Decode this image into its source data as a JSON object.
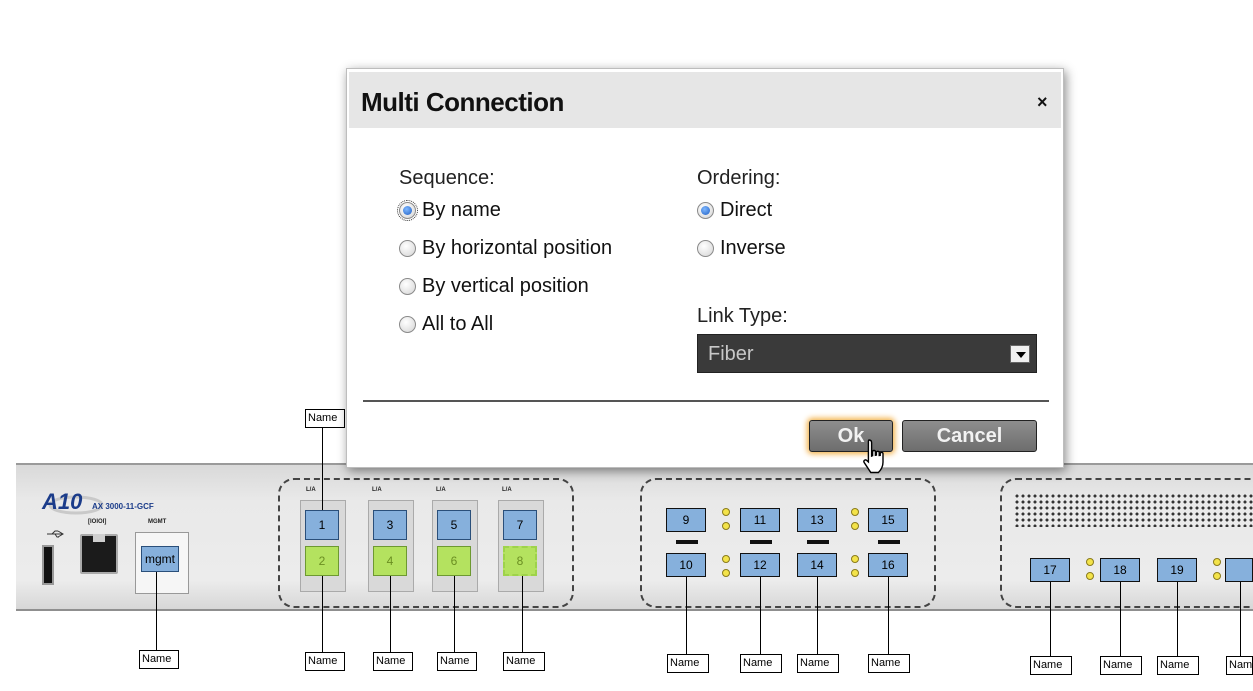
{
  "dialog": {
    "title": "Multi Connection",
    "close_glyph": "×",
    "sequence_label": "Sequence:",
    "sequence_options": [
      {
        "label": "By name",
        "selected": true
      },
      {
        "label": "By horizontal position",
        "selected": false
      },
      {
        "label": "By vertical position",
        "selected": false
      },
      {
        "label": "All to All",
        "selected": false
      }
    ],
    "ordering_label": "Ordering:",
    "ordering_options": [
      {
        "label": "Direct",
        "selected": true
      },
      {
        "label": "Inverse",
        "selected": false
      }
    ],
    "link_type_label": "Link Type:",
    "link_type_value": "Fiber",
    "ok_label": "Ok",
    "cancel_label": "Cancel"
  },
  "device": {
    "brand": "A10",
    "model": "AX 3000-11-GCF",
    "console_label": "[IOIOI]",
    "mgmt_label": "MGMT",
    "mgmt_port": "mgmt",
    "copper_ports": [
      "1",
      "2",
      "3",
      "4",
      "5",
      "6",
      "7",
      "8"
    ],
    "sfp_ports_a": [
      "9",
      "10",
      "11",
      "12",
      "13",
      "14",
      "15",
      "16"
    ],
    "sfp_ports_b": [
      "17",
      "18",
      "19"
    ],
    "port_hint": "L/A",
    "name_tag": "Name"
  },
  "colors": {
    "port_blue": "#86b0dc",
    "port_green": "#b4e25f",
    "button_gray": "#6d6d6d",
    "select_bg": "#3a3a3a",
    "ok_glow": "#f3b24a"
  },
  "icons": [
    "close-icon",
    "radio-icon",
    "dropdown-arrow-icon",
    "hand-pointer-icon",
    "a10-logo-icon",
    "usb-icon"
  ]
}
